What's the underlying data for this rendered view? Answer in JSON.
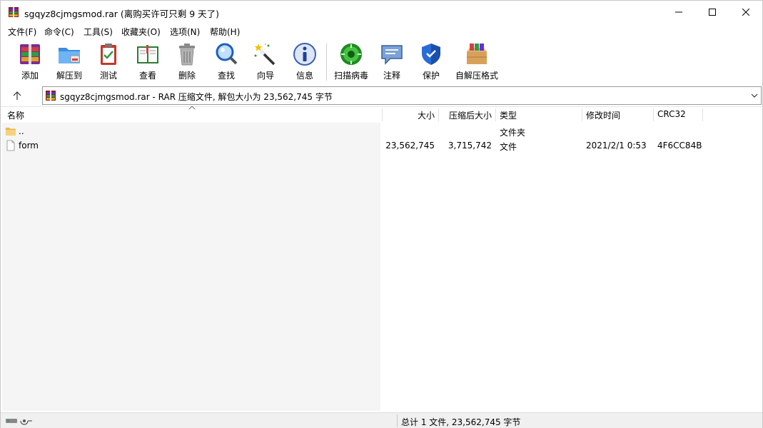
{
  "window": {
    "title": "sgqyz8cjmgsmod.rar (离购买许可只剩 9 天了)"
  },
  "menu": [
    {
      "label": "文件(F)"
    },
    {
      "label": "命令(C)"
    },
    {
      "label": "工具(S)"
    },
    {
      "label": "收藏夹(O)"
    },
    {
      "label": "选项(N)"
    },
    {
      "label": "帮助(H)"
    }
  ],
  "toolbar": [
    {
      "label": "添加",
      "icon": "add-archive-icon"
    },
    {
      "label": "解压到",
      "icon": "extract-to-icon"
    },
    {
      "label": "测试",
      "icon": "test-clipboard-icon"
    },
    {
      "label": "查看",
      "icon": "view-book-icon"
    },
    {
      "label": "删除",
      "icon": "trash-icon"
    },
    {
      "label": "查找",
      "icon": "magnifier-icon"
    },
    {
      "label": "向导",
      "icon": "wizard-wand-icon"
    },
    {
      "label": "信息",
      "icon": "info-icon"
    },
    {
      "label": "扫描病毒",
      "icon": "virus-scan-icon"
    },
    {
      "label": "注释",
      "icon": "comment-icon"
    },
    {
      "label": "保护",
      "icon": "shield-icon"
    },
    {
      "label": "自解压格式",
      "icon": "sfx-box-icon"
    }
  ],
  "address": {
    "path": "sgqyz8cjmgsmod.rar - RAR 压缩文件, 解包大小为 23,562,745 字节"
  },
  "columns": {
    "name": "名称",
    "size": "大小",
    "packed": "压缩后大小",
    "type": "类型",
    "modified": "修改时间",
    "crc": "CRC32"
  },
  "files": [
    {
      "name": "..",
      "size": "",
      "packed": "",
      "type": "文件夹",
      "modified": "",
      "crc": "",
      "icon": "folder-icon"
    },
    {
      "name": "form",
      "size": "23,562,745",
      "packed": "3,715,742",
      "type": "文件",
      "modified": "2021/2/1 0:53",
      "crc": "4F6CC84B",
      "icon": "file-icon"
    }
  ],
  "status": {
    "summary": "总计 1 文件, 23,562,745 字节"
  },
  "colors": {
    "list_bg": "#f5f5f5",
    "status_bg": "#f0f0f0"
  }
}
